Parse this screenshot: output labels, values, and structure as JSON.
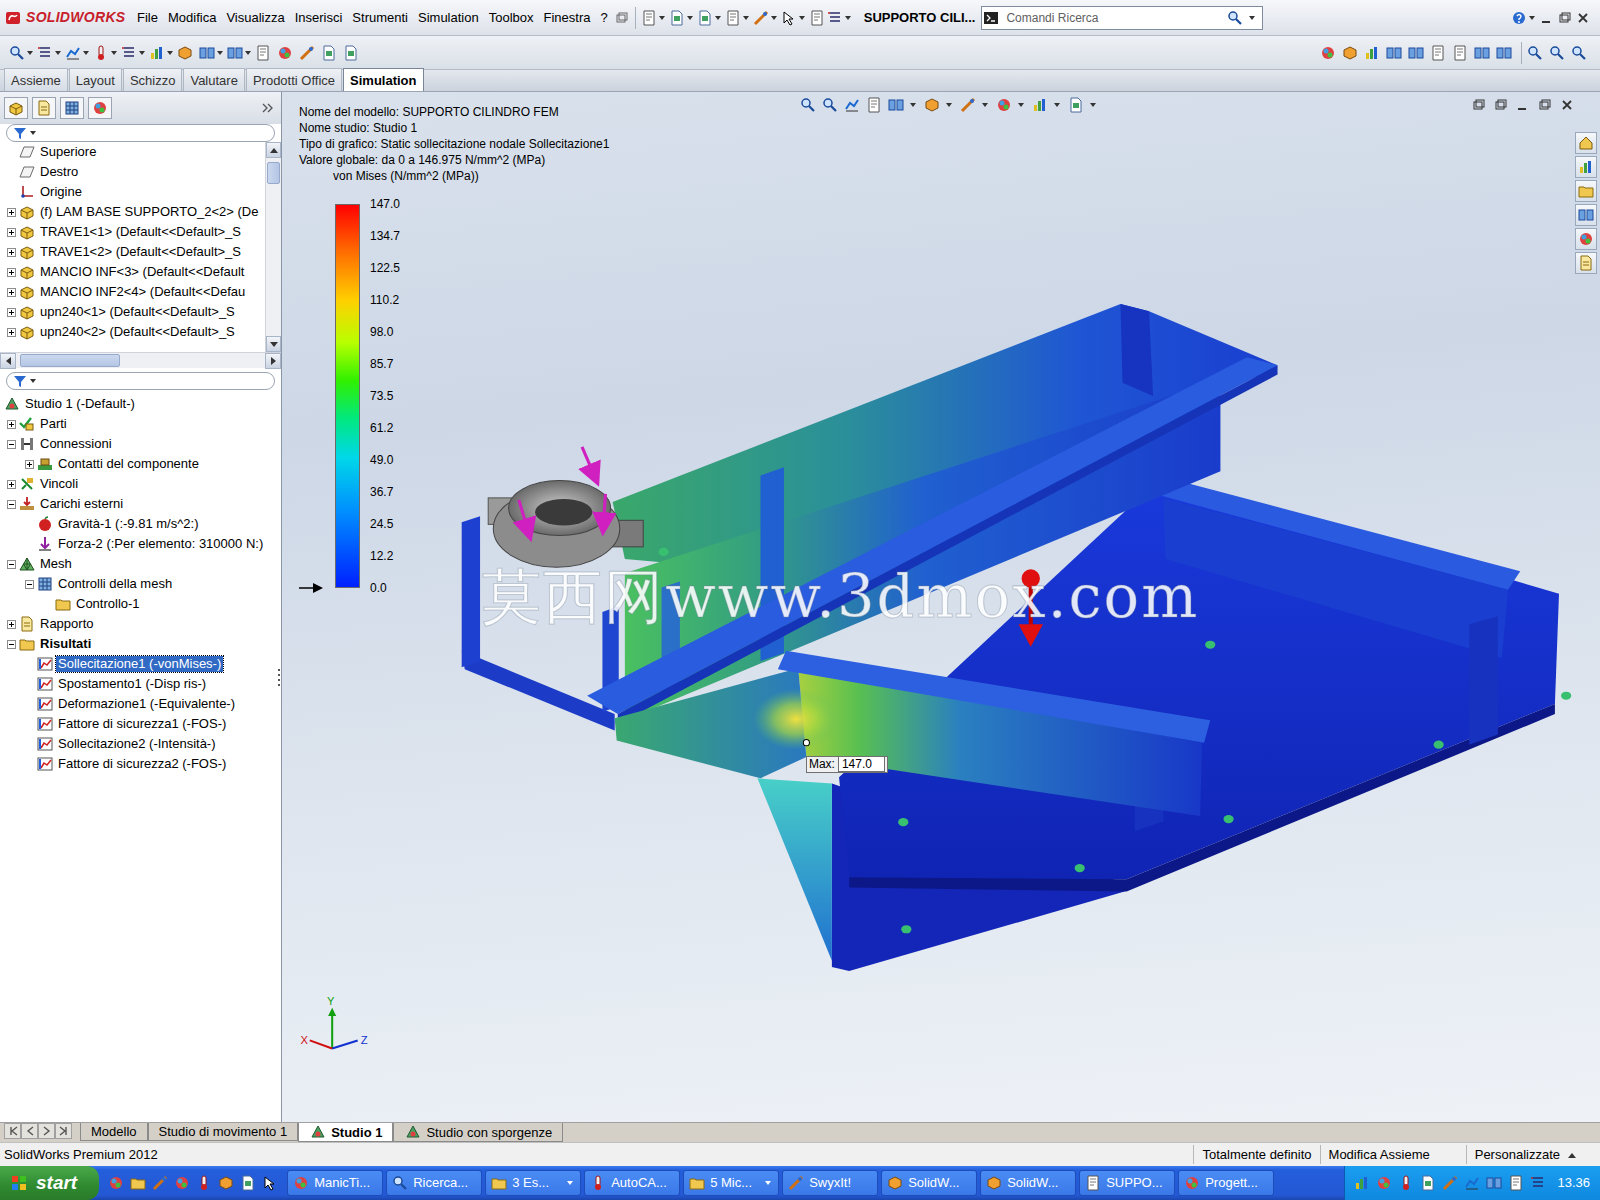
{
  "window": {
    "app": "SOLIDWORKS",
    "title": "SUPPORTO CILI..."
  },
  "menu": [
    "File",
    "Modifica",
    "Visualizza",
    "Inserisci",
    "Strumenti",
    "Simulation",
    "Toolbox",
    "Finestra",
    "?"
  ],
  "search": {
    "placeholder": "Comandi Ricerca"
  },
  "command_tabs": [
    {
      "label": "Assieme",
      "selected": false
    },
    {
      "label": "Layout",
      "selected": false
    },
    {
      "label": "Schizzo",
      "selected": false
    },
    {
      "label": "Valutare",
      "selected": false
    },
    {
      "label": "Prodotti Office",
      "selected": false
    },
    {
      "label": "Simulation",
      "selected": true
    }
  ],
  "feature_tree": [
    {
      "label": "Superiore",
      "kind": "plane"
    },
    {
      "label": "Destro",
      "kind": "plane"
    },
    {
      "label": "Origine",
      "kind": "origin"
    },
    {
      "label": "(f) LAM BASE SUPPORTO_2<2> (De",
      "kind": "part",
      "expanded": false
    },
    {
      "label": "TRAVE1<1> (Default<<Default>_S",
      "kind": "part",
      "expanded": false
    },
    {
      "label": "TRAVE1<2> (Default<<Default>_S",
      "kind": "part",
      "expanded": false
    },
    {
      "label": "MANCIO INF<3> (Default<<Default",
      "kind": "part",
      "expanded": false
    },
    {
      "label": "MANCIO INF2<4> (Default<<Defau",
      "kind": "part",
      "expanded": false
    },
    {
      "label": "upn240<1> (Default<<Default>_S",
      "kind": "part",
      "expanded": false
    },
    {
      "label": "upn240<2> (Default<<Default>_S",
      "kind": "part",
      "expanded": false
    }
  ],
  "study_tree": [
    {
      "label": "Studio 1 (-Default-)",
      "kind": "study",
      "level": 0,
      "emphasized": false,
      "selected": false
    },
    {
      "label": "Parti",
      "kind": "parts",
      "level": 1,
      "expanded": false,
      "emphasized": false,
      "selected": false
    },
    {
      "label": "Connessioni",
      "kind": "connections",
      "level": 1,
      "expanded": true,
      "emphasized": false,
      "selected": false
    },
    {
      "label": "Contatti del componente",
      "kind": "contacts",
      "level": 2,
      "expanded": false,
      "emphasized": false,
      "selected": false
    },
    {
      "label": "Vincoli",
      "kind": "fixtures",
      "level": 1,
      "expanded": false,
      "emphasized": false,
      "selected": false
    },
    {
      "label": "Carichi esterni",
      "kind": "loads",
      "level": 1,
      "expanded": true,
      "emphasized": false,
      "selected": false
    },
    {
      "label": "Gravità-1 (:-9.81 m/s^2:)",
      "kind": "gravity",
      "level": 2,
      "emphasized": false,
      "selected": false
    },
    {
      "label": "Forza-2 (:Per elemento: 310000 N:)",
      "kind": "force",
      "level": 2,
      "emphasized": false,
      "selected": false
    },
    {
      "label": "Mesh",
      "kind": "mesh",
      "level": 1,
      "expanded": true,
      "emphasized": false,
      "selected": false
    },
    {
      "label": "Controlli della mesh",
      "kind": "meshctrl",
      "level": 2,
      "expanded": true,
      "emphasized": false,
      "selected": false
    },
    {
      "label": "Controllo-1",
      "kind": "control",
      "level": 3,
      "emphasized": false,
      "selected": false
    },
    {
      "label": "Rapporto",
      "kind": "report",
      "level": 1,
      "expanded": false,
      "emphasized": false,
      "selected": false
    },
    {
      "label": "Risultati",
      "kind": "results",
      "level": 1,
      "expanded": true,
      "emphasized": true,
      "selected": false
    },
    {
      "label": "Sollecitazione1 (-vonMises-)",
      "kind": "plot",
      "level": 2,
      "emphasized": false,
      "selected": true
    },
    {
      "label": "Spostamento1 (-Disp ris-)",
      "kind": "plot",
      "level": 2,
      "emphasized": false,
      "selected": false
    },
    {
      "label": "Deformazione1 (-Equivalente-)",
      "kind": "plot",
      "level": 2,
      "emphasized": false,
      "selected": false
    },
    {
      "label": "Fattore di sicurezza1 (-FOS-)",
      "kind": "plot",
      "level": 2,
      "emphasized": false,
      "selected": false
    },
    {
      "label": "Sollecitazione2 (-Intensità-)",
      "kind": "plot",
      "level": 2,
      "emphasized": false,
      "selected": false
    },
    {
      "label": "Fattore di sicurezza2 (-FOS-)",
      "kind": "plot",
      "level": 2,
      "emphasized": false,
      "selected": false
    }
  ],
  "viewport": {
    "info": [
      "Nome del modello: SUPPORTO CILINDRO FEM",
      "Nome studio: Studio 1",
      "Tipo di grafico: Static sollecitazione nodale Sollecitazione1",
      "Valore globale: da 0 a 146.975 N/mm^2 (MPa)"
    ],
    "legend": {
      "title": "von Mises (N/mm^2 (MPa))",
      "ticks": [
        "147.0",
        "134.7",
        "122.5",
        "110.2",
        "98.0",
        "85.7",
        "73.5",
        "61.2",
        "49.0",
        "36.7",
        "24.5",
        "12.2",
        "0.0"
      ]
    },
    "max_probe": {
      "label": "Max:",
      "value": "147.0"
    },
    "watermark": "莫西网www.3dmox.com",
    "axes": {
      "y": "Y",
      "z": "Z",
      "x": "X"
    }
  },
  "bottom_tabs": [
    {
      "label": "Modello",
      "selected": false
    },
    {
      "label": "Studio di movimento 1",
      "selected": false
    },
    {
      "label": "Studio 1",
      "selected": true
    },
    {
      "label": "Studio con sporgenze",
      "selected": false
    }
  ],
  "status_bar": {
    "left": "SolidWorks Premium 2012",
    "right": [
      "Totalmente definito",
      "Modifica Assieme",
      "Personalizzate"
    ]
  },
  "taskbar": {
    "start": "start",
    "items": [
      {
        "label": "ManicTi...",
        "grouped": false
      },
      {
        "label": "Ricerca...",
        "grouped": false
      },
      {
        "label": "3 Es...",
        "grouped": true
      },
      {
        "label": "AutoCA...",
        "grouped": false
      },
      {
        "label": "5 Mic...",
        "grouped": true
      },
      {
        "label": "SwyxIt!",
        "grouped": false
      },
      {
        "label": "SolidW...",
        "grouped": false
      },
      {
        "label": "SolidW...",
        "grouped": false
      },
      {
        "label": "SUPPO...",
        "grouped": false
      },
      {
        "label": "Progett...",
        "grouped": false
      }
    ],
    "clock": "13.36"
  }
}
